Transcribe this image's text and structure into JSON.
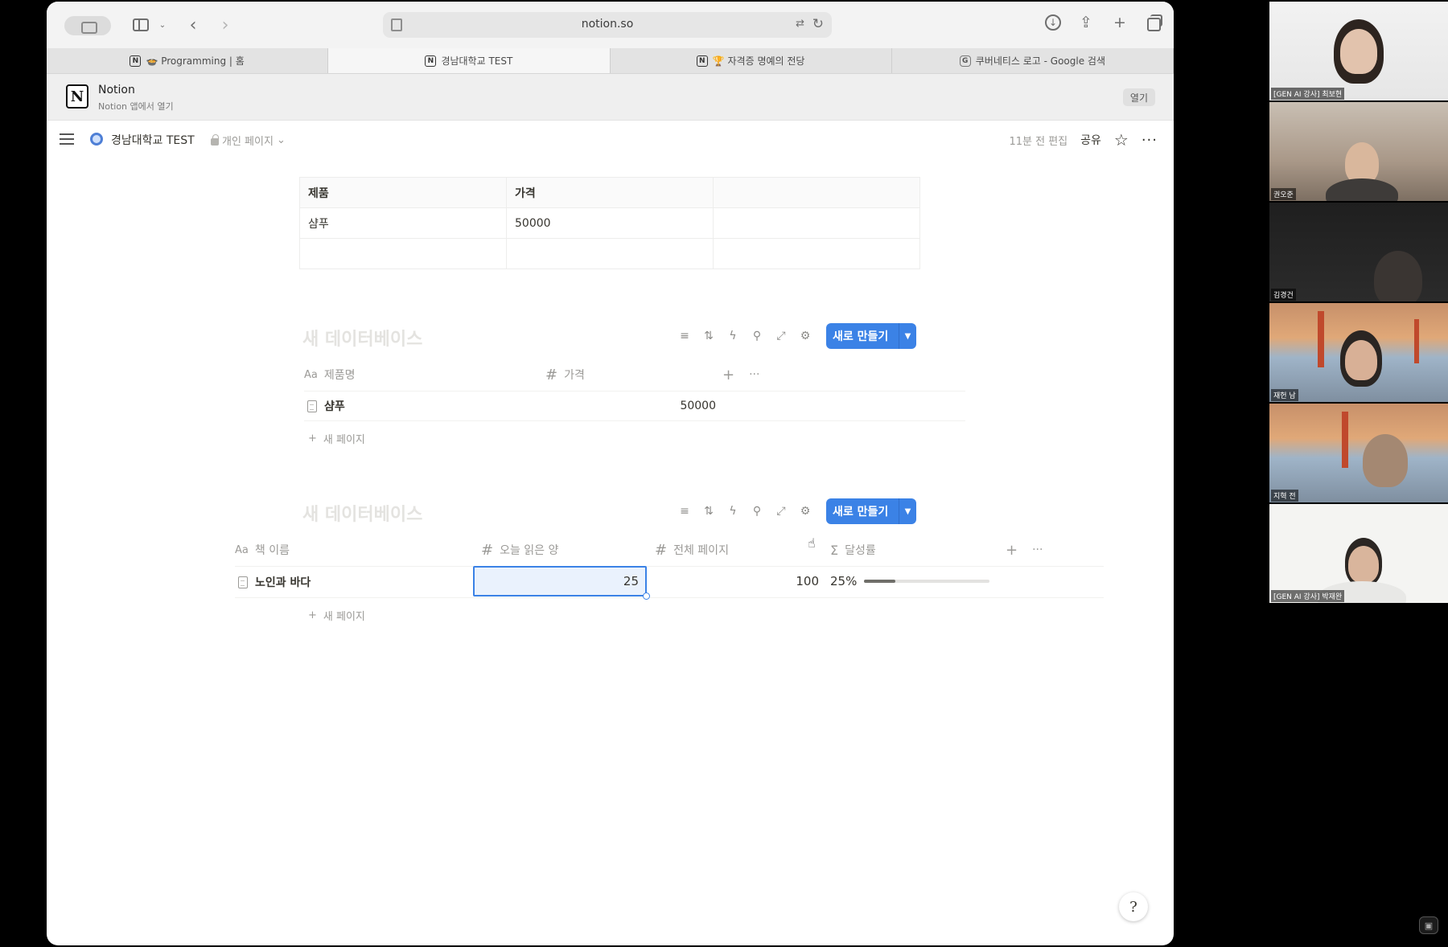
{
  "browser": {
    "url": "notion.so",
    "tabs": [
      {
        "label": "🍲 Programming | 홈",
        "favicon": "N",
        "active": false
      },
      {
        "label": "경남대학교 TEST",
        "favicon": "N",
        "active": true
      },
      {
        "label": "🏆 자격증 명예의 전당",
        "favicon": "N",
        "active": false
      },
      {
        "label": "쿠버네티스 로고 - Google 검색",
        "favicon": "G",
        "active": false
      }
    ]
  },
  "banner": {
    "app_name": "Notion",
    "subtitle": "Notion 앱에서 열기",
    "open_label": "열기"
  },
  "topbar": {
    "page_title": "경남대학교 TEST",
    "visibility": "개인 페이지",
    "edited": "11분 전 편집",
    "share_label": "공유"
  },
  "simple_table": {
    "rows": [
      [
        "제품",
        "가격",
        ""
      ],
      [
        "샴푸",
        "50000",
        ""
      ],
      [
        "",
        "",
        ""
      ]
    ]
  },
  "database1": {
    "title": "새 데이터베이스",
    "new_button": "새로 만들기",
    "columns": [
      {
        "name": "제품명",
        "type": "title"
      },
      {
        "name": "가격",
        "type": "number"
      }
    ],
    "rows": [
      {
        "name": "샴푸",
        "price": "50000"
      }
    ],
    "new_page_label": "새 페이지"
  },
  "database2": {
    "title": "새 데이터베이스",
    "new_button": "새로 만들기",
    "columns": [
      {
        "name": "책 이름",
        "type": "title"
      },
      {
        "name": "오늘 읽은 양",
        "type": "number"
      },
      {
        "name": "전체 페이지",
        "type": "number"
      },
      {
        "name": "달성률",
        "type": "formula"
      }
    ],
    "rows": [
      {
        "name": "노인과 바다",
        "read_today": "25",
        "total_pages": "100",
        "achievement": "25%",
        "achievement_fraction": 0.25
      }
    ],
    "new_page_label": "새 페이지"
  },
  "video_call": {
    "participants": [
      {
        "label": "[GEN AI 강사] 최보현"
      },
      {
        "label": "권오준"
      },
      {
        "label": "김경건"
      },
      {
        "label": "재헌 남"
      },
      {
        "label": "지혁 전"
      },
      {
        "label": "[GEN AI 강사] 박재완"
      }
    ]
  },
  "colors": {
    "accent": "#3b82e6",
    "text": "#37352f",
    "muted": "#9b9a97"
  }
}
